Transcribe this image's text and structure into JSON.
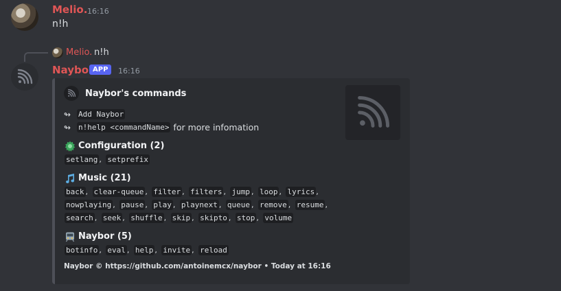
{
  "message1": {
    "author": "Melio.",
    "author_color": "#e05656",
    "time": "16:16",
    "content": "n!h"
  },
  "reply": {
    "author": "Melio.",
    "content": "n!h"
  },
  "message2": {
    "author": "Naybor",
    "author_color": "#e05656",
    "badge": "APP",
    "time": "16:16"
  },
  "embed": {
    "author": "Naybor's commands",
    "add_link": "Add Naybor",
    "help_code": "n!help <commandName>",
    "help_suffix": " for more infomation",
    "arrow_glyph": "↬",
    "fields": [
      {
        "icon": "gear-icon",
        "title": "Configuration (2)",
        "values": [
          "setlang",
          "setprefix"
        ]
      },
      {
        "icon": "music-note-icon",
        "title": "Music (21)",
        "values": [
          "back",
          "clear-queue",
          "filter",
          "filters",
          "jump",
          "loop",
          "lyrics",
          "nowplaying",
          "pause",
          "play",
          "playnext",
          "queue",
          "remove",
          "resume",
          "search",
          "seek",
          "shuffle",
          "skip",
          "skipto",
          "stop",
          "volume"
        ]
      },
      {
        "icon": "train-icon",
        "title": "Naybor (5)",
        "values": [
          "botinfo",
          "eval",
          "help",
          "invite",
          "reload"
        ]
      }
    ],
    "footer": "Naybor © https://github.com/antoinemcx/naybor • Today at 16:16"
  }
}
